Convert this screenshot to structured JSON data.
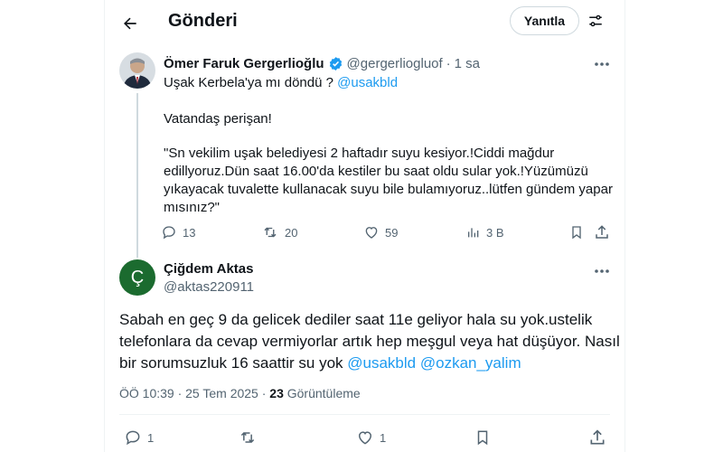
{
  "header": {
    "title": "Gönderi",
    "reply_button": "Yanıtla"
  },
  "quoted_post": {
    "author_name": "Ömer Faruk Gergerlioğlu",
    "handle": "@gergerliogluof",
    "separator": "·",
    "time": "1 sa",
    "line1_text": "Uşak Kerbela'ya mı döndü ? ",
    "line1_mention": "@usakbld",
    "line2": "Vatandaş perişan!",
    "quote_lines": [
      "\"Sn vekilim uşak belediyesi 2 haftadır suyu kesiyor.!Ciddi mağdur",
      "edillyoruz.Dün saat 16.00'da kestiler bu saat oldu sular yok.!Yüzümüzü",
      "yıkayacak tuvalette kullanacak suyu bile bulamıyoruz..lütfen gündem yapar",
      "mısınız?\""
    ],
    "stats": {
      "replies": "13",
      "reposts": "20",
      "likes": "59",
      "views": "3 B"
    }
  },
  "main_post": {
    "avatar_letter": "Ç",
    "author_name": "Çiğdem Aktas",
    "handle": "@aktas220911",
    "text_lines": [
      "Sabah en geç 9 da gelicek dediler saat 11e geliyor hala su yok.ustelik",
      "telefonlara da cevap vermiyorlar artık hep meşgul veya hat düşüyor. Nasıl"
    ],
    "text_line3": "bir sorumsuzluk 16 saattir su yok ",
    "mention1": "@usakbld",
    "mention2": "@ozkan_yalim",
    "meta_time": "ÖÖ 10:39 · 25 Tem 2025 · ",
    "meta_views_count": "23",
    "meta_views_label": " Görüntüleme",
    "stats": {
      "replies": "1",
      "likes": "1"
    }
  },
  "colors": {
    "accent": "#1d9bf0",
    "avatar_green": "#1b6b2f",
    "muted": "#536471"
  }
}
